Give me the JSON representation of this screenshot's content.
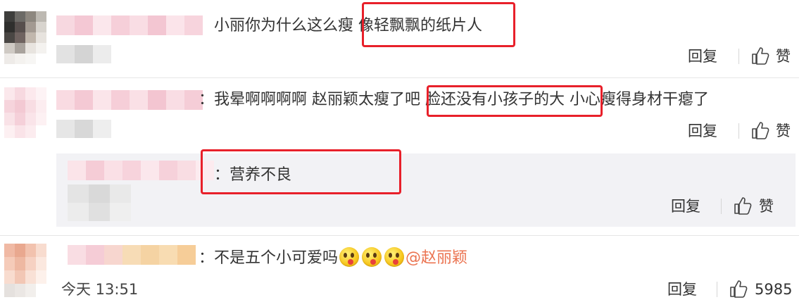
{
  "comments": [
    {
      "text": "小丽你为什么这么瘦 像轻飘飘的纸片人",
      "highlight_text": "像轻飘飘的纸片人",
      "actions": {
        "reply": "回复",
        "like": "赞"
      }
    },
    {
      "text": "：我晕啊啊啊啊 赵丽颖太瘦了吧 脸还没有小孩子的大 小心瘦得身材干瘪了",
      "highlight_text": "脸还没有小孩子的大",
      "actions": {
        "reply": "回复",
        "like": "赞"
      },
      "reply": {
        "text": "：营养不良",
        "actions": {
          "reply": "回复",
          "like": "赞"
        }
      }
    },
    {
      "text": "：不是五个小可爱吗",
      "mention": "@赵丽颖",
      "time": "今天 13:51",
      "actions": {
        "reply": "回复",
        "like": "5985"
      }
    }
  ],
  "colors": {
    "highlight": "#e8202a",
    "mention": "#eb7350"
  },
  "icons": {
    "like": "thumbs-up-icon",
    "emoji": "smiley-emoji-icon"
  }
}
